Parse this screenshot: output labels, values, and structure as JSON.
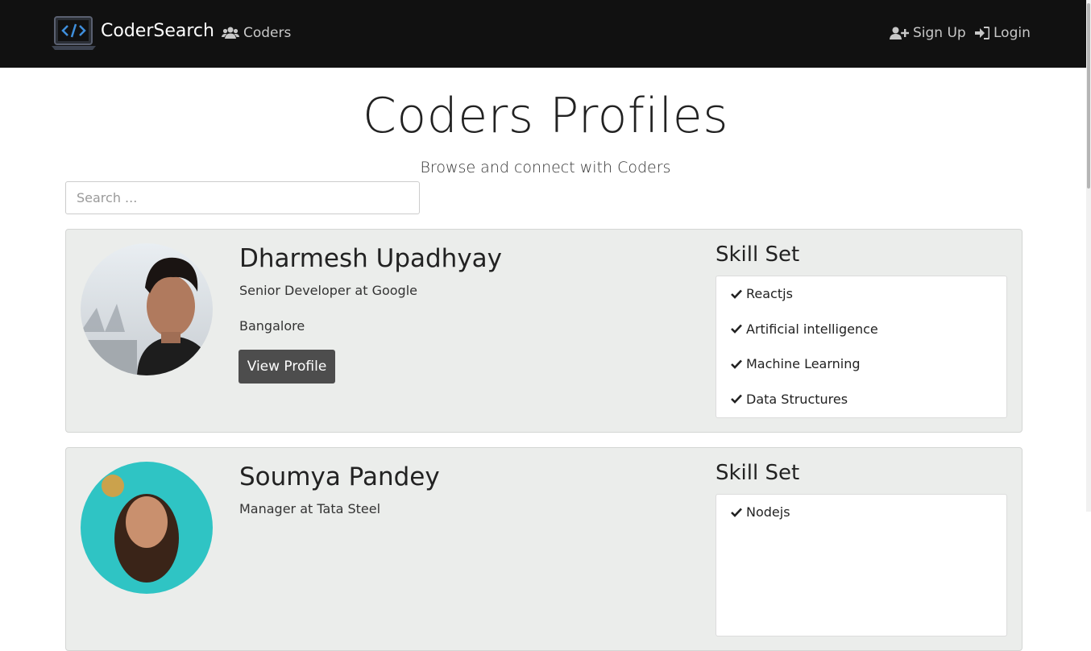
{
  "navbar": {
    "brand": "CoderSearch",
    "links": {
      "coders": "Coders",
      "signup": "Sign Up",
      "login": "Login"
    }
  },
  "hero": {
    "title": "Coders Profiles",
    "subtitle": "Browse and connect with Coders",
    "search_placeholder": "Search ..."
  },
  "profiles": [
    {
      "name": "Dharmesh Upadhyay",
      "role": "Senior Developer at Google",
      "city": "Bangalore",
      "button": "View Profile",
      "skills_heading": "Skill Set",
      "skills": [
        "Reactjs",
        "Artificial intelligence",
        "Machine Learning",
        "Data Structures"
      ]
    },
    {
      "name": "Soumya Pandey",
      "role": "Manager at Tata Steel",
      "skills_heading": "Skill Set",
      "skills": [
        "Nodejs"
      ]
    }
  ],
  "colors": {
    "navbar": "#111111",
    "card": "#ebedeb",
    "button": "#4d4d4d",
    "logo_accent": "#3f8fdc"
  }
}
